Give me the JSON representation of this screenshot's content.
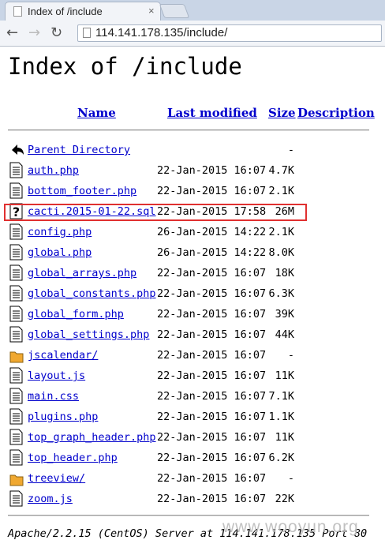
{
  "browser": {
    "tab_title": "Index of /include",
    "close_glyph": "×",
    "url": "114.141.178.135/include/"
  },
  "page": {
    "title": "Index of /include",
    "headers": {
      "name": "Name",
      "last_modified": "Last modified",
      "size": "Size",
      "description": "Description"
    },
    "rows": [
      {
        "icon": "back-icon",
        "name": "Parent Directory",
        "date": "",
        "size": "-"
      },
      {
        "icon": "file-icon",
        "name": "auth.php",
        "date": "22-Jan-2015 16:07",
        "size": "4.7K"
      },
      {
        "icon": "file-icon",
        "name": "bottom_footer.php",
        "date": "22-Jan-2015 16:07",
        "size": "2.1K"
      },
      {
        "icon": "unknown-icon",
        "name": "cacti.2015-01-22.sql",
        "date": "22-Jan-2015 17:58",
        "size": "26M"
      },
      {
        "icon": "file-icon",
        "name": "config.php",
        "date": "26-Jan-2015 14:22",
        "size": "2.1K"
      },
      {
        "icon": "file-icon",
        "name": "global.php",
        "date": "26-Jan-2015 14:22",
        "size": "8.0K"
      },
      {
        "icon": "file-icon",
        "name": "global_arrays.php",
        "date": "22-Jan-2015 16:07",
        "size": "18K"
      },
      {
        "icon": "file-icon",
        "name": "global_constants.php",
        "date": "22-Jan-2015 16:07",
        "size": "6.3K"
      },
      {
        "icon": "file-icon",
        "name": "global_form.php",
        "date": "22-Jan-2015 16:07",
        "size": "39K"
      },
      {
        "icon": "file-icon",
        "name": "global_settings.php",
        "date": "22-Jan-2015 16:07",
        "size": "44K"
      },
      {
        "icon": "folder-icon",
        "name": "jscalendar/",
        "date": "22-Jan-2015 16:07",
        "size": "-"
      },
      {
        "icon": "file-icon",
        "name": "layout.js",
        "date": "22-Jan-2015 16:07",
        "size": "11K"
      },
      {
        "icon": "file-icon",
        "name": "main.css",
        "date": "22-Jan-2015 16:07",
        "size": "7.1K"
      },
      {
        "icon": "file-icon",
        "name": "plugins.php",
        "date": "22-Jan-2015 16:07",
        "size": "1.1K"
      },
      {
        "icon": "file-icon",
        "name": "top_graph_header.php",
        "date": "22-Jan-2015 16:07",
        "size": "11K"
      },
      {
        "icon": "file-icon",
        "name": "top_header.php",
        "date": "22-Jan-2015 16:07",
        "size": "6.2K"
      },
      {
        "icon": "folder-icon",
        "name": "treeview/",
        "date": "22-Jan-2015 16:07",
        "size": "-"
      },
      {
        "icon": "file-icon",
        "name": "zoom.js",
        "date": "22-Jan-2015 16:07",
        "size": "22K"
      }
    ],
    "footer": "Apache/2.2.15 (CentOS) Server at 114.141.178.135 Port 80"
  },
  "watermark": "www.wooyun.org",
  "colors": {
    "link": "#0000cc",
    "highlight": "#e03030",
    "folder": "#f0a830"
  }
}
